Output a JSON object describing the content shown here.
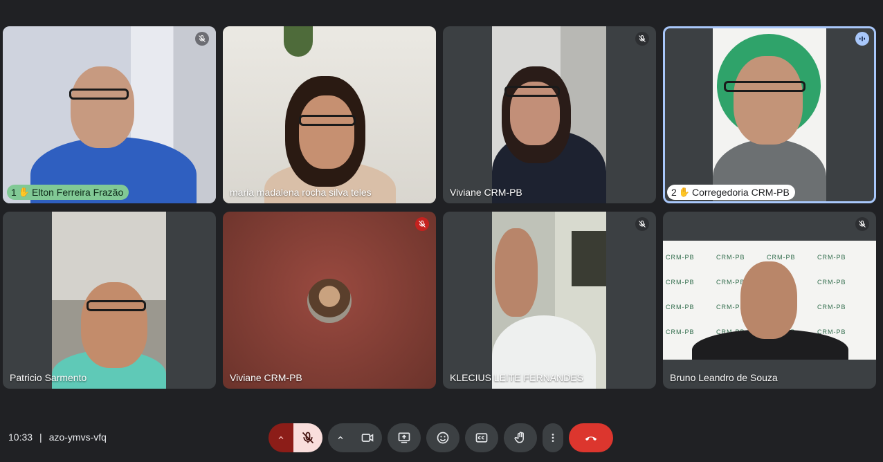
{
  "tiles": [
    {
      "name": "Elton Ferreira Frazão",
      "hand": "1",
      "muted": true
    },
    {
      "name": "maria madalena rocha silva teles",
      "muted": false
    },
    {
      "name": "Viviane CRM-PB",
      "muted": true
    },
    {
      "name": "Corregedoria CRM-PB",
      "hand": "2",
      "speaking": true
    },
    {
      "name": "Patricio Sarmento",
      "muted": false
    },
    {
      "name": "Viviane CRM-PB",
      "muted": true,
      "camera_off": true
    },
    {
      "name": "KLECIUS LEITE FERNANDES",
      "muted": true
    },
    {
      "name": "Bruno Leandro de Souza",
      "muted": true
    }
  ],
  "meeting": {
    "time": "10:33",
    "separator": "|",
    "code": "azo-ymvs-vfq"
  },
  "backdrop_logo_text": "CRM-PB",
  "colors": {
    "background": "#202124",
    "tile": "#3c4043",
    "raised_hand_pill": "#81c995",
    "end_call": "#dc362e",
    "mic_off": "#f9dedc",
    "active_border": "#a8c7fa"
  },
  "icons": {
    "muted": "mic-off-icon",
    "hand": "hand-raised-icon",
    "speaking": "audio-wave-icon",
    "camera": "camera-icon",
    "present": "present-screen-icon",
    "emoji": "emoji-icon",
    "captions": "captions-icon",
    "more": "more-vert-icon",
    "end": "end-call-icon"
  }
}
